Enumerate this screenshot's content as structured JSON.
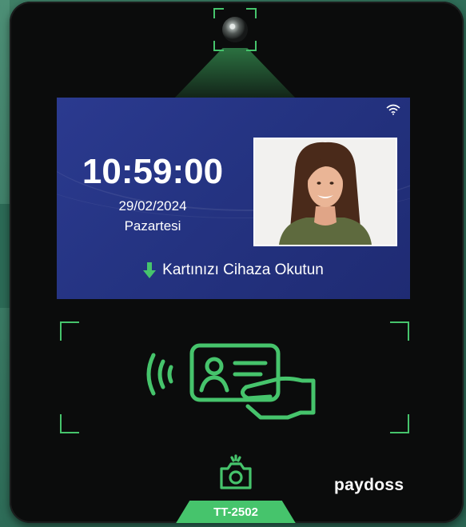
{
  "screen": {
    "time": "10:59:00",
    "date": "29/02/2024",
    "weekday": "Pazartesi",
    "instruction": "Kartınızı Cihaza Okutun",
    "wifi_icon": "wifi-icon",
    "arrow_icon": "arrow-down-icon"
  },
  "device": {
    "brand": "paydoss",
    "model": "TT-2502"
  },
  "icons": {
    "camera": "camera-lens-icon",
    "reader": "nfc-card-reader-icon",
    "capture": "camera-icon"
  },
  "colors": {
    "accent": "#46c46c",
    "screen_bg": "#253483",
    "device_bg": "#0b0c0c"
  }
}
